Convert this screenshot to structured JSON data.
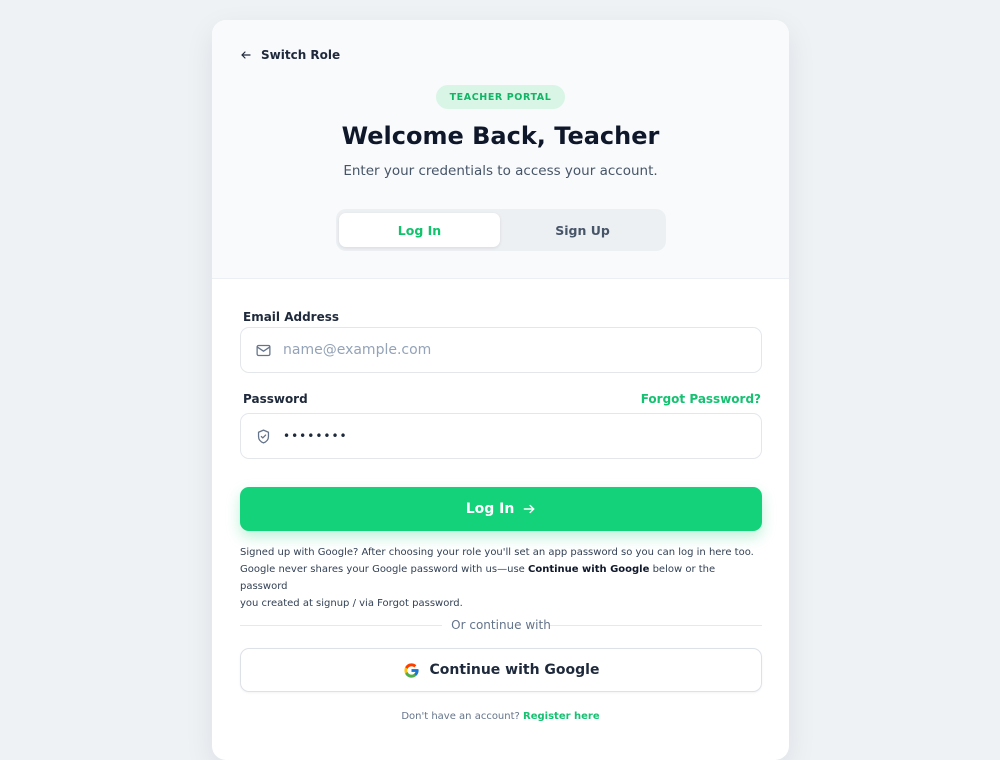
{
  "header": {
    "back_label": "Switch Role",
    "badge": "TEACHER PORTAL",
    "title": "Welcome Back, Teacher",
    "subtitle": "Enter your credentials to access your account."
  },
  "tabs": {
    "login": "Log In",
    "signup": "Sign Up"
  },
  "form": {
    "email_label": "Email Address",
    "email_placeholder": "name@example.com",
    "password_label": "Password",
    "forgot_label": "Forgot Password?",
    "password_value": "••••••••",
    "submit_label": "Log In"
  },
  "note": {
    "line1": "Signed up with Google? After choosing your role you'll set an app password so you can log in here too.",
    "line2_pre": "Google never shares your Google password with us—use ",
    "line2_bold": "Continue with Google",
    "line2_post": " below or the password",
    "line3": "you created at signup / via Forgot password."
  },
  "divider_text": "Or continue with",
  "google_label": "Continue with Google",
  "footer": {
    "prompt": "Don't have an account?",
    "register": "Register here"
  },
  "colors": {
    "accent": "#14d27a",
    "accent_text": "#16c172",
    "badge_bg": "#d9f5e6",
    "page_bg": "#eef2f5"
  },
  "icons": {
    "back": "arrow-left-icon",
    "email": "mail-icon",
    "password": "shield-check-icon",
    "submit": "arrow-right-icon",
    "google": "google-logo-icon"
  }
}
